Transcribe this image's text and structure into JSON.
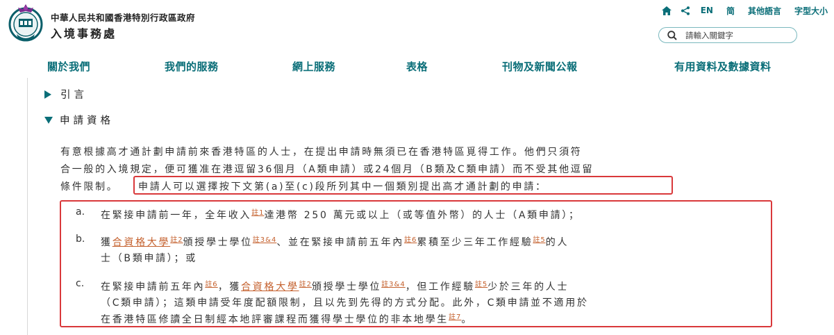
{
  "header": {
    "gov_name": "中華人民共和國香港特別行政區政府",
    "dept_name": "入境事務處",
    "util": {
      "home_icon": "home-icon",
      "share_icon": "share-icon",
      "en": "EN",
      "sc": "简",
      "other_langs": "其他語言",
      "font_size": "字型大小"
    },
    "search": {
      "placeholder": "請輸入關鍵字",
      "icon": "search-icon"
    },
    "colors": {
      "accent": "#0a6e78",
      "highlight_border": "#d9383a",
      "note_link": "#c4602d"
    }
  },
  "nav": [
    "關於我們",
    "我們的服務",
    "網上服務",
    "表格",
    "刊物及新聞公報",
    "有用資料及數據資料"
  ],
  "accordion": {
    "intro_label": "引言",
    "eligibility_label": "申請資格"
  },
  "eligibility": {
    "para_line1": "有意根據高才通計劃申請前來香港特區的人士，在提出申請時無須已在香港特區覓得工作。他們只須符",
    "para_line2": "合一般的入境規定，便可獲准在港逗留36個月（A類申請）或24個月（B類及C類申請）而不受其他逗留",
    "para_line3_start": "條件限制。",
    "para_line3_highlight": "申請人可以選擇按下文第(a)至(c)段所列其中一個類別提出高才通計劃的申請：",
    "items": {
      "a": {
        "marker": "a.",
        "line1_part1": "在緊接申請前一年，全年收入",
        "note1": "註1",
        "line1_part2": "達港幣 250 萬元或以上（或等值外幣）的人士（A類申請）；"
      },
      "b": {
        "marker": "b.",
        "line1_part1": "獲",
        "link1": "合資格大學",
        "note1": "註2",
        "line1_part2": "頒授學士學位",
        "note2": "註3&4",
        "line1_part3": "、並在緊接申請前五年內",
        "note3": "註6",
        "line1_part4": "累積至少三年工作經驗",
        "note4": "註5",
        "line1_part5": "的人",
        "line2": "士（B類申請）；或"
      },
      "c": {
        "marker": "c.",
        "line1_part1": "在緊接申請前五年內",
        "note1": "註6",
        "line1_part2": "，獲",
        "link1": "合資格大學",
        "note2": "註2",
        "line1_part3": "頒授學士學位",
        "note3": "註3&4",
        "line1_part4": "，但工作經驗",
        "note4": "註5",
        "line1_part5": "少於三年的人士",
        "line2": "（C類申請）；這類申請受年度配額限制，且以先到先得的方式分配。此外，C類申請並不適用於",
        "line3_part1": "在香港特區修讀全日制經本地評審課程而獲得學士學位的非本地學生",
        "note5": "註7",
        "line3_part2": "。"
      }
    }
  }
}
